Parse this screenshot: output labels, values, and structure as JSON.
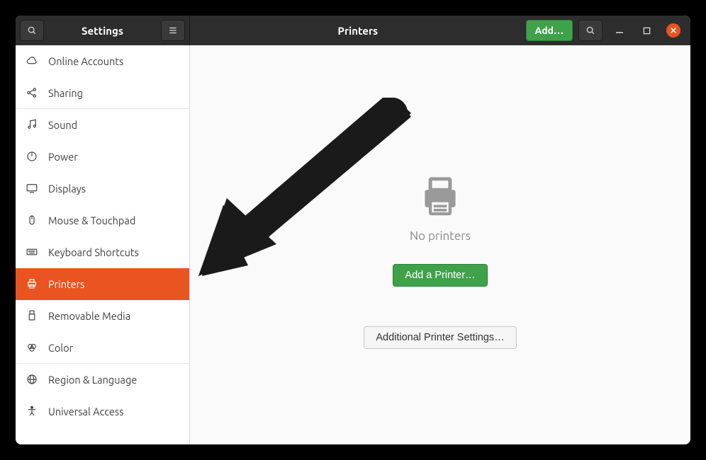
{
  "header": {
    "settings_title": "Settings",
    "panel_title": "Printers",
    "add_button": "Add…"
  },
  "sidebar": {
    "items": [
      {
        "id": "online-accounts",
        "icon": "cloud",
        "label": "Online Accounts",
        "selected": false,
        "sep": false
      },
      {
        "id": "sharing",
        "icon": "share",
        "label": "Sharing",
        "selected": false,
        "sep": true
      },
      {
        "id": "sound",
        "icon": "music",
        "label": "Sound",
        "selected": false,
        "sep": false
      },
      {
        "id": "power",
        "icon": "power",
        "label": "Power",
        "selected": false,
        "sep": false
      },
      {
        "id": "displays",
        "icon": "display",
        "label": "Displays",
        "selected": false,
        "sep": false
      },
      {
        "id": "mouse-touchpad",
        "icon": "mouse",
        "label": "Mouse & Touchpad",
        "selected": false,
        "sep": false
      },
      {
        "id": "keyboard-shortcuts",
        "icon": "keyboard",
        "label": "Keyboard Shortcuts",
        "selected": false,
        "sep": false
      },
      {
        "id": "printers",
        "icon": "printer",
        "label": "Printers",
        "selected": true,
        "sep": false
      },
      {
        "id": "removable-media",
        "icon": "usb",
        "label": "Removable Media",
        "selected": false,
        "sep": false
      },
      {
        "id": "color",
        "icon": "color",
        "label": "Color",
        "selected": false,
        "sep": true
      },
      {
        "id": "region-language",
        "icon": "globe",
        "label": "Region & Language",
        "selected": false,
        "sep": false
      },
      {
        "id": "universal-access",
        "icon": "access",
        "label": "Universal Access",
        "selected": false,
        "sep": false
      }
    ]
  },
  "main": {
    "no_printers_text": "No printers",
    "add_printer_button": "Add a Printer…",
    "additional_settings_button": "Additional Printer Settings…"
  }
}
